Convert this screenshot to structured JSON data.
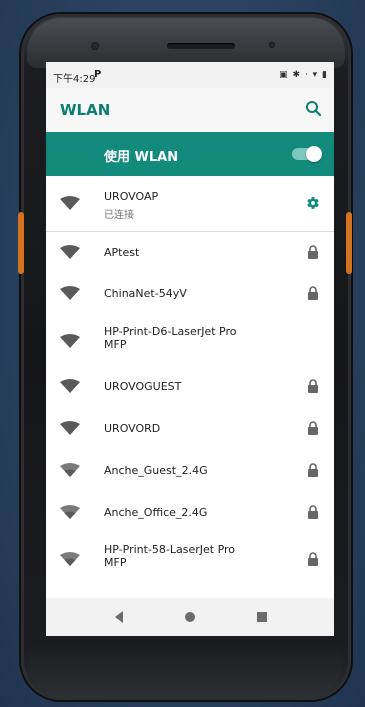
{
  "status_bar": {
    "time": "下午4:29",
    "app_indicator": "P",
    "icons_text": "▣ ✱ · ▾ ▮"
  },
  "app_bar": {
    "title": "WLAN",
    "search_icon": "search-icon"
  },
  "master_switch": {
    "label": "使用 WLAN",
    "enabled": true
  },
  "networks": [
    {
      "name": "UROVOAP",
      "status": "已连接",
      "end_icon": "gear-icon"
    },
    {
      "name": "APtest",
      "end_icon": "lock-icon"
    },
    {
      "name": "ChinaNet-54yV",
      "end_icon": "lock-icon"
    },
    {
      "name": "HP-Print-D6-LaserJet Pro MFP",
      "end_icon": "none"
    },
    {
      "name": "UROVOGUEST",
      "end_icon": "lock-icon"
    },
    {
      "name": "UROVORD",
      "end_icon": "lock-icon"
    },
    {
      "name": "Anche_Guest_2.4G",
      "end_icon": "lock-icon"
    },
    {
      "name": "Anche_Office_2.4G",
      "end_icon": "lock-icon"
    },
    {
      "name": "HP-Print-58-LaserJet Pro MFP",
      "end_icon": "lock-icon"
    }
  ],
  "nav_bar": {
    "back_icon": "back-icon",
    "home_icon": "home-icon",
    "recents_icon": "recents-icon"
  },
  "colors": {
    "accent": "#138b7c",
    "title": "#0c7d72",
    "device_side_key": "#d4731f"
  }
}
